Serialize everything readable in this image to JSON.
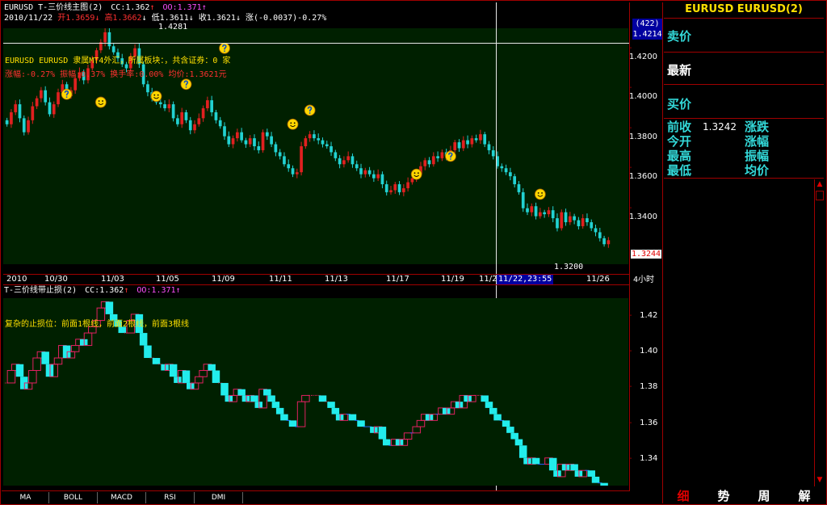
{
  "main_chart": {
    "title": "EURUSD T-三价线主图(2)",
    "cc_label": "CC:1.362",
    "cc_arrow": "↑",
    "oo_label": "OO:1.371",
    "oo_arrow": "↑",
    "ohlc_line": {
      "date": "2010/11/22",
      "open": "开1.3659",
      "open_arrow": "↓",
      "high": "高1.3662",
      "high_arrow": "↓",
      "low": "低1.3611",
      "low_arrow": "↓",
      "close": "收1.3621",
      "close_arrow": "↓",
      "change": "涨(-0.0037)-0.27%"
    },
    "info_line": "EURUSD EURUSD 隶属MT4外汇，所属板块：，共含证券：0 家",
    "stats_line": "涨幅:-0.27% 振幅:0.37% 换手率:0.00% 均价:1.3621元",
    "high_marker": "1.4281",
    "low_marker": "1.3200",
    "count_badge": "(422)",
    "cursor_price": "1.4214",
    "last_price": "1.3244",
    "y_ticks": [
      "1.4200",
      "1.4000",
      "1.3800",
      "1.3600",
      "1.3400"
    ],
    "x_ticks": [
      "2010",
      "10/30",
      "11/03",
      "11/05",
      "11/09",
      "11/11",
      "11/13",
      "11/17",
      "11/19",
      "11/21",
      "11/26"
    ],
    "cursor_time": "11/22,23:55",
    "period": "4小时",
    "colors": {
      "up": "#e02020",
      "down": "#22d2d2",
      "bg": "#002000",
      "smiley": "#ffd700"
    }
  },
  "indicator": {
    "title": "T-三价线带止损(2)",
    "cc_label": "CC:1.362",
    "cc_arrow": "↑",
    "oo_label": "OO:1.371",
    "oo_arrow": "↑",
    "note": "复杂的止损位：前面1根线，前面2根线，前面3根线",
    "y_ticks": [
      "1.42",
      "1.40",
      "1.38",
      "1.36",
      "1.34"
    ]
  },
  "right_panel": {
    "title": "EURUSD EURUSD(2)",
    "sell_label": "卖价",
    "latest_label": "最新",
    "buy_label": "买价",
    "prev_close_label": "前收",
    "prev_close_value": "1.3242",
    "change_label": "涨跌",
    "open_label": "今开",
    "change_pct_label": "涨幅",
    "high_label": "最高",
    "amplitude_label": "振幅",
    "low_label": "最低",
    "avg_label": "均价"
  },
  "bottom_tabs": [
    "MA",
    "BOLL",
    "MACD",
    "RSI",
    "DMI"
  ],
  "right_tabs": [
    "细",
    "势",
    "周",
    "解"
  ],
  "chart_data": {
    "type": "candlestick",
    "ylim": [
      1.312,
      1.43
    ],
    "close_series": [
      1.382,
      1.388,
      1.392,
      1.385,
      1.378,
      1.384,
      1.391,
      1.395,
      1.399,
      1.393,
      1.387,
      1.392,
      1.398,
      1.402,
      1.396,
      1.399,
      1.405,
      1.408,
      1.404,
      1.41,
      1.414,
      1.419,
      1.423,
      1.428,
      1.421,
      1.418,
      1.415,
      1.412,
      1.41,
      1.416,
      1.42,
      1.412,
      1.402,
      1.398,
      1.395,
      1.393,
      1.392,
      1.39,
      1.392,
      1.385,
      1.382,
      1.388,
      1.384,
      1.379,
      1.382,
      1.385,
      1.39,
      1.394,
      1.388,
      1.384,
      1.381,
      1.376,
      1.372,
      1.375,
      1.378,
      1.374,
      1.372,
      1.375,
      1.371,
      1.369,
      1.378,
      1.376,
      1.372,
      1.368,
      1.366,
      1.362,
      1.36,
      1.357,
      1.358,
      1.371,
      1.375,
      1.377,
      1.375,
      1.374,
      1.372,
      1.371,
      1.368,
      1.365,
      1.362,
      1.364,
      1.366,
      1.362,
      1.36,
      1.357,
      1.359,
      1.357,
      1.355,
      1.357,
      1.352,
      1.348,
      1.349,
      1.352,
      1.348,
      1.35,
      1.353,
      1.355,
      1.357,
      1.361,
      1.364,
      1.362,
      1.366,
      1.365,
      1.368,
      1.366,
      1.369,
      1.373,
      1.37,
      1.374,
      1.372,
      1.375,
      1.374,
      1.377,
      1.372,
      1.369,
      1.366,
      1.361,
      1.36,
      1.358,
      1.356,
      1.352,
      1.348,
      1.34,
      1.338,
      1.341,
      1.336,
      1.338,
      1.337,
      1.339,
      1.335,
      1.33,
      1.338,
      1.333,
      1.336,
      1.334,
      1.331,
      1.335,
      1.333,
      1.33,
      1.328,
      1.325,
      1.322,
      1.324
    ],
    "markers": [
      {
        "type": "question",
        "x_index": 14,
        "y": 1.397
      },
      {
        "type": "smile",
        "x_index": 22,
        "y": 1.393
      },
      {
        "type": "smile",
        "x_index": 35,
        "y": 1.396
      },
      {
        "type": "question",
        "x_index": 42,
        "y": 1.402
      },
      {
        "type": "question",
        "x_index": 51,
        "y": 1.42
      },
      {
        "type": "question",
        "x_index": 71,
        "y": 1.389
      },
      {
        "type": "smile",
        "x_index": 67,
        "y": 1.382
      },
      {
        "type": "smile",
        "x_index": 96,
        "y": 1.357
      },
      {
        "type": "question",
        "x_index": 104,
        "y": 1.366
      },
      {
        "type": "smile",
        "x_index": 125,
        "y": 1.347
      },
      {
        "type": "question",
        "x_index": 150,
        "y": 1.363
      }
    ]
  }
}
